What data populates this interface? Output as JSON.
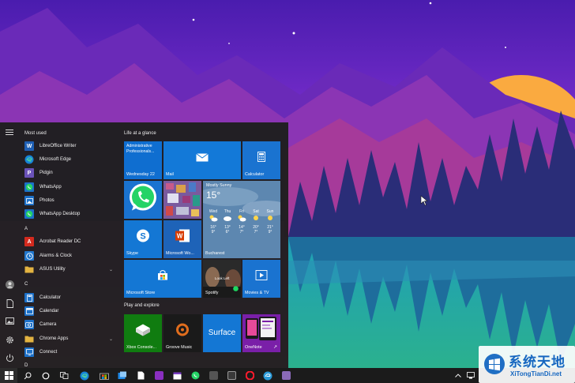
{
  "wallpaper": {
    "sky_top": "#5a23b8",
    "sky_mid": "#a53ad0",
    "sun": "#f9a33a",
    "forest": "#1d2a6b",
    "water": "#1fa2b9"
  },
  "start_menu": {
    "rail_icons": [
      "hamburger-icon",
      "user-avatar",
      "documents-icon",
      "pictures-icon",
      "settings-icon",
      "power-icon"
    ],
    "most_used_header": "Most used",
    "most_used": [
      {
        "label": "LibreOffice Writer",
        "icon": "writer-icon",
        "color": "#1e5fb4"
      },
      {
        "label": "Microsoft Edge",
        "icon": "edge-icon",
        "color": "#1683d8"
      },
      {
        "label": "Pidgin",
        "icon": "pidgin-icon",
        "color": "#6a52b8"
      },
      {
        "label": "WhatsApp",
        "icon": "whatsapp-icon",
        "color": "#25c04a"
      },
      {
        "label": "Photos",
        "icon": "photos-icon",
        "color": "#1c70c8"
      },
      {
        "label": "WhatsApp Desktop",
        "icon": "whatsapp-icon",
        "color": "#25c04a"
      }
    ],
    "groups": [
      {
        "letter": "A",
        "items": [
          {
            "label": "Acrobat Reader DC",
            "icon": "acrobat-icon",
            "color": "#d32a1e",
            "chevron": false
          },
          {
            "label": "Alarms & Clock",
            "icon": "alarm-icon",
            "color": "#2277cc",
            "chevron": false
          },
          {
            "label": "ASUS Utility",
            "icon": "folder-icon",
            "color": "#e3b341",
            "chevron": true
          }
        ]
      },
      {
        "letter": "C",
        "items": [
          {
            "label": "Calculator",
            "icon": "calculator-icon",
            "color": "#1c70c8",
            "chevron": false
          },
          {
            "label": "Calendar",
            "icon": "calendar-icon",
            "color": "#1c70c8",
            "chevron": false
          },
          {
            "label": "Camera",
            "icon": "camera-icon",
            "color": "#1c70c8",
            "chevron": false
          },
          {
            "label": "Chrome Apps",
            "icon": "folder-icon",
            "color": "#e3b341",
            "chevron": true
          },
          {
            "label": "Connect",
            "icon": "connect-icon",
            "color": "#1c70c8",
            "chevron": false
          }
        ]
      },
      {
        "letter": "D",
        "items": []
      }
    ],
    "tiles": {
      "life_header": "Life at a glance",
      "play_header": "Play and explore",
      "mail_preview": {
        "line1": "Administrative",
        "line2": "Professionals...",
        "day": "Wednesday 22"
      },
      "mail": "Mail",
      "calculator": "Calculator",
      "whatsapp_icon": "whatsapp-icon",
      "weather": {
        "condition": "Mostly Sunny",
        "temp": "15°",
        "days": [
          {
            "d": "Wed",
            "hi": "16°",
            "lo": "9°"
          },
          {
            "d": "Thu",
            "hi": "13°",
            "lo": "6°"
          },
          {
            "d": "Fri",
            "hi": "14°",
            "lo": "7°"
          },
          {
            "d": "Sat",
            "hi": "20°",
            "lo": "7°"
          },
          {
            "d": "Sun",
            "hi": "21°",
            "lo": "9°"
          }
        ],
        "city": "Bucharest"
      },
      "skype": "Skype",
      "word": "Microsoft Wo...",
      "store": "Microsoft Store",
      "spotify": "Spotify",
      "spotify_caption": "Look Left",
      "movies": "Movies & TV",
      "xbox": "Xbox Console...",
      "groove": "Groove Music",
      "surface": "Surface",
      "onenote": "OneNote"
    }
  },
  "taskbar": {
    "items": [
      "start-icon",
      "search-icon",
      "cortana-icon",
      "task-view-icon",
      "edge-icon",
      "store-icon",
      "files-icon",
      "onenote-icon",
      "calendar-icon",
      "whatsapp-icon",
      "app-icon",
      "app-icon",
      "opera-icon",
      "edge-beta-icon",
      "app-icon"
    ],
    "tray": [
      "chevron-up-icon",
      "network-icon"
    ]
  },
  "watermark": {
    "title": "系统天地",
    "url": "XiTongTianDi.net"
  }
}
